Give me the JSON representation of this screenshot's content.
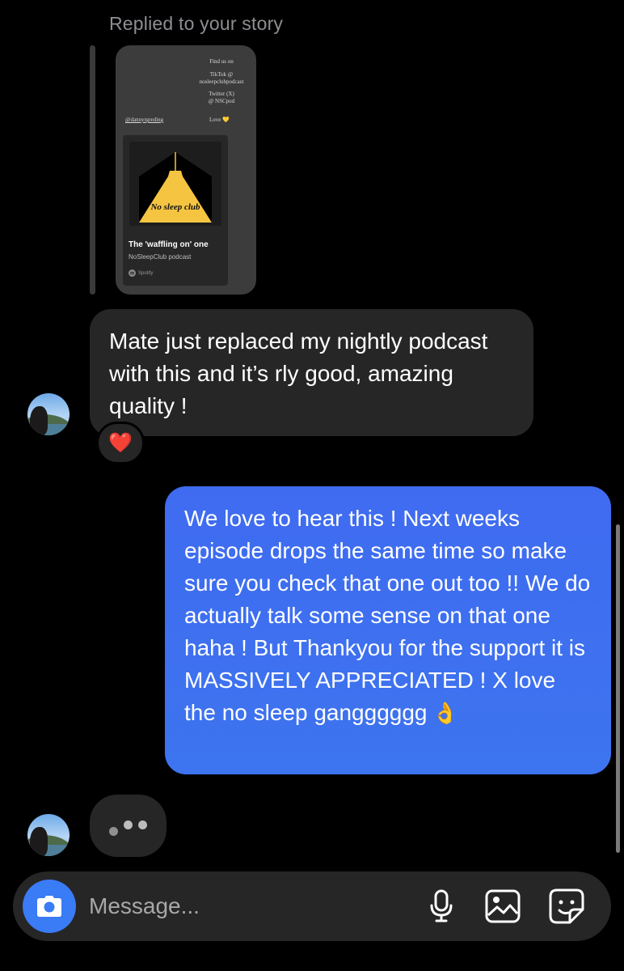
{
  "thread": {
    "replied_label": "Replied to your story",
    "story": {
      "find_us": "Find us on",
      "tiktok_line1": "TikTok @",
      "tiktok_line2": "nosleepclubpodcast",
      "twitter_line1": "Twitter (X)",
      "twitter_line2": "@ NSCpod",
      "handle": "@dannyrgreding",
      "love": "Love",
      "love_emoji": "💛",
      "cover_logo_text": "No sleep club",
      "episode_title": "The 'waffling on' one",
      "show_name": "NoSleepClub podcast",
      "platform": "Spotify"
    },
    "incoming_message": "Mate just replaced my nightly podcast with this and it’s rly good, amazing quality !",
    "reaction": "❤️",
    "outgoing_message": "We love to hear this ! Next weeks episode drops the same time so make sure you check that one out too !! We do actually talk some sense on that one haha ! But Thankyou for the support it is MASSIVELY APPRECIATED ! X love the no sleep gangggggg",
    "outgoing_emoji": "👌"
  },
  "composer": {
    "placeholder": "Message..."
  },
  "icons": {
    "camera": "camera-icon",
    "mic": "microphone-icon",
    "gallery": "gallery-icon",
    "sticker": "sticker-icon"
  },
  "colors": {
    "background": "#000000",
    "incoming_bubble": "#262626",
    "outgoing_bubble": "#3f6bf0",
    "camera_button": "#3a7bf6",
    "cover_yellow": "#f5c542"
  }
}
